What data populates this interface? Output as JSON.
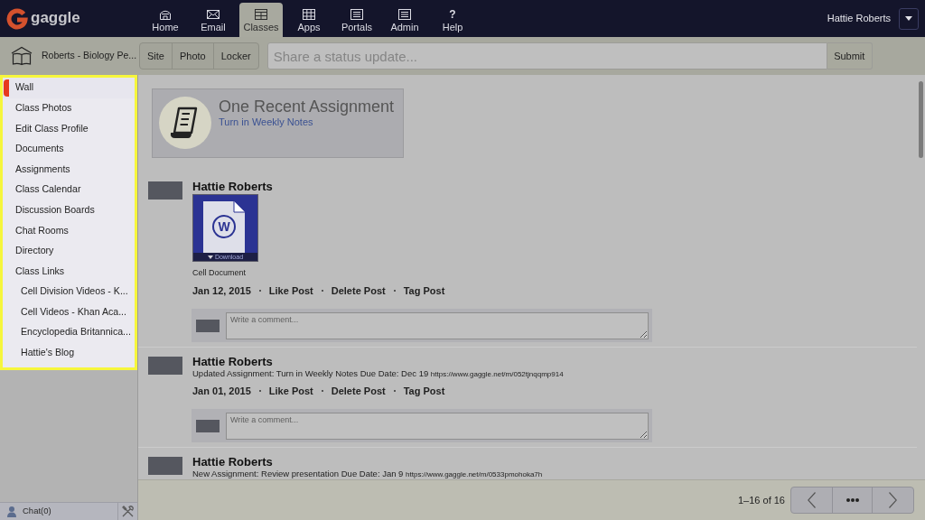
{
  "header": {
    "logo": "gaggle",
    "nav": [
      {
        "label": "Home",
        "selected": false
      },
      {
        "label": "Email",
        "selected": false
      },
      {
        "label": "Classes",
        "selected": true
      },
      {
        "label": "Apps",
        "selected": false
      },
      {
        "label": "Portals",
        "selected": false
      },
      {
        "label": "Admin",
        "selected": false
      },
      {
        "label": "Help",
        "selected": false,
        "symbol": "?"
      }
    ],
    "user": "Hattie Roberts"
  },
  "toolbar": {
    "class_name": "Roberts - Biology Pe...",
    "buttons": [
      "Site",
      "Photo",
      "Locker"
    ],
    "status_field": {
      "placeholder": "Share a status update..."
    },
    "submit": "Submit"
  },
  "sidebar": {
    "items": [
      {
        "label": "Wall",
        "selected": true
      },
      {
        "label": "Class Photos",
        "selected": false
      },
      {
        "label": "Edit Class Profile",
        "selected": false
      },
      {
        "label": "Documents",
        "selected": false
      },
      {
        "label": "Assignments",
        "selected": false
      },
      {
        "label": "Class Calendar",
        "selected": false
      },
      {
        "label": "Discussion Boards",
        "selected": false
      },
      {
        "label": "Chat Rooms",
        "selected": false
      },
      {
        "label": "Directory",
        "selected": false
      },
      {
        "label": "Class Links",
        "selected": false,
        "children": [
          {
            "label": "Cell Division Videos - K...",
            "selected": false
          },
          {
            "label": "Cell Videos - Khan Aca...",
            "selected": false
          },
          {
            "label": "Encyclopedia Britannica...",
            "selected": false
          },
          {
            "label": "Hattie's Blog",
            "selected": false
          }
        ]
      }
    ]
  },
  "chat": {
    "label": "Chat(0)"
  },
  "assignment_card": {
    "title": "One Recent Assignment",
    "link": "Turn in Weekly Notes"
  },
  "posts": [
    {
      "author": "Hattie Roberts",
      "kind": "attachment",
      "attachment": {
        "letter": "W",
        "action": "Download",
        "caption": "Cell Document"
      },
      "date": "Jan 12, 2015",
      "actions": [
        "Like Post",
        "Delete Post",
        "Tag Post"
      ],
      "comment": {
        "placeholder": "Write a comment..."
      }
    },
    {
      "author": "Hattie Roberts",
      "kind": "update",
      "text": "Updated Assignment: Turn in Weekly Notes Due Date: Dec 19",
      "link": "https://www.gaggle.net/m/052tjnqqmp914",
      "date": "Jan 01, 2015",
      "actions": [
        "Like Post",
        "Delete Post",
        "Tag Post"
      ],
      "comment": {
        "placeholder": "Write a comment..."
      }
    },
    {
      "author": "Hattie Roberts",
      "kind": "update",
      "text": "New Assignment: Review presentation Due Date: Jan 9",
      "link": "https://www.gaggle.net/m/0533pmohoka7h"
    }
  ],
  "pager": {
    "range": "1–16 of 16"
  }
}
